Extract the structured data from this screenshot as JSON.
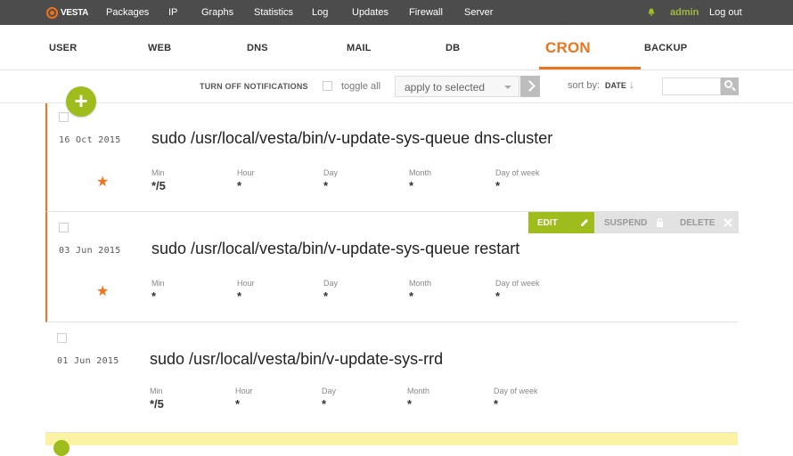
{
  "topbar": {
    "logo_text": "VESTA",
    "nav": [
      "Packages",
      "IP",
      "Graphs",
      "Statistics",
      "Log",
      "Updates",
      "Firewall",
      "Server"
    ],
    "user": "admin",
    "logout": "Log out"
  },
  "tabs": [
    "USER",
    "WEB",
    "DNS",
    "MAIL",
    "DB",
    "CRON",
    "BACKUP"
  ],
  "active_tab": "CRON",
  "toolbar": {
    "turn_off": "TURN OFF NOTIFICATIONS",
    "toggle_all": "toggle all",
    "apply_placeholder": "apply to selected",
    "sort_by": "sort by:",
    "sort_value": "DATE",
    "sort_arrow": "↓"
  },
  "labels": {
    "min": "Min",
    "hour": "Hour",
    "day": "Day",
    "month": "Month",
    "dow": "Day of week"
  },
  "jobs": [
    {
      "date": "16 Oct 2015",
      "command": "sudo /usr/local/vesta/bin/v-update-sys-queue dns-cluster",
      "min": "*/5",
      "hour": "*",
      "day": "*",
      "month": "*",
      "dow": "*"
    },
    {
      "date": "03 Jun 2015",
      "command": "sudo /usr/local/vesta/bin/v-update-sys-queue restart",
      "min": "*",
      "hour": "*",
      "day": "*",
      "month": "*",
      "dow": "*"
    },
    {
      "date": "01 Jun 2015",
      "command": "sudo /usr/local/vesta/bin/v-update-sys-rrd",
      "min": "*/5",
      "hour": "*",
      "day": "*",
      "month": "*",
      "dow": "*"
    }
  ],
  "actions": {
    "edit": "EDIT",
    "suspend": "SUSPEND",
    "delete": "DELETE"
  },
  "colors": {
    "accent": "#f0731c",
    "green": "#9fbc1d",
    "topbar": "#4c4c4c"
  },
  "icons": {
    "add": "+",
    "star": "★"
  }
}
